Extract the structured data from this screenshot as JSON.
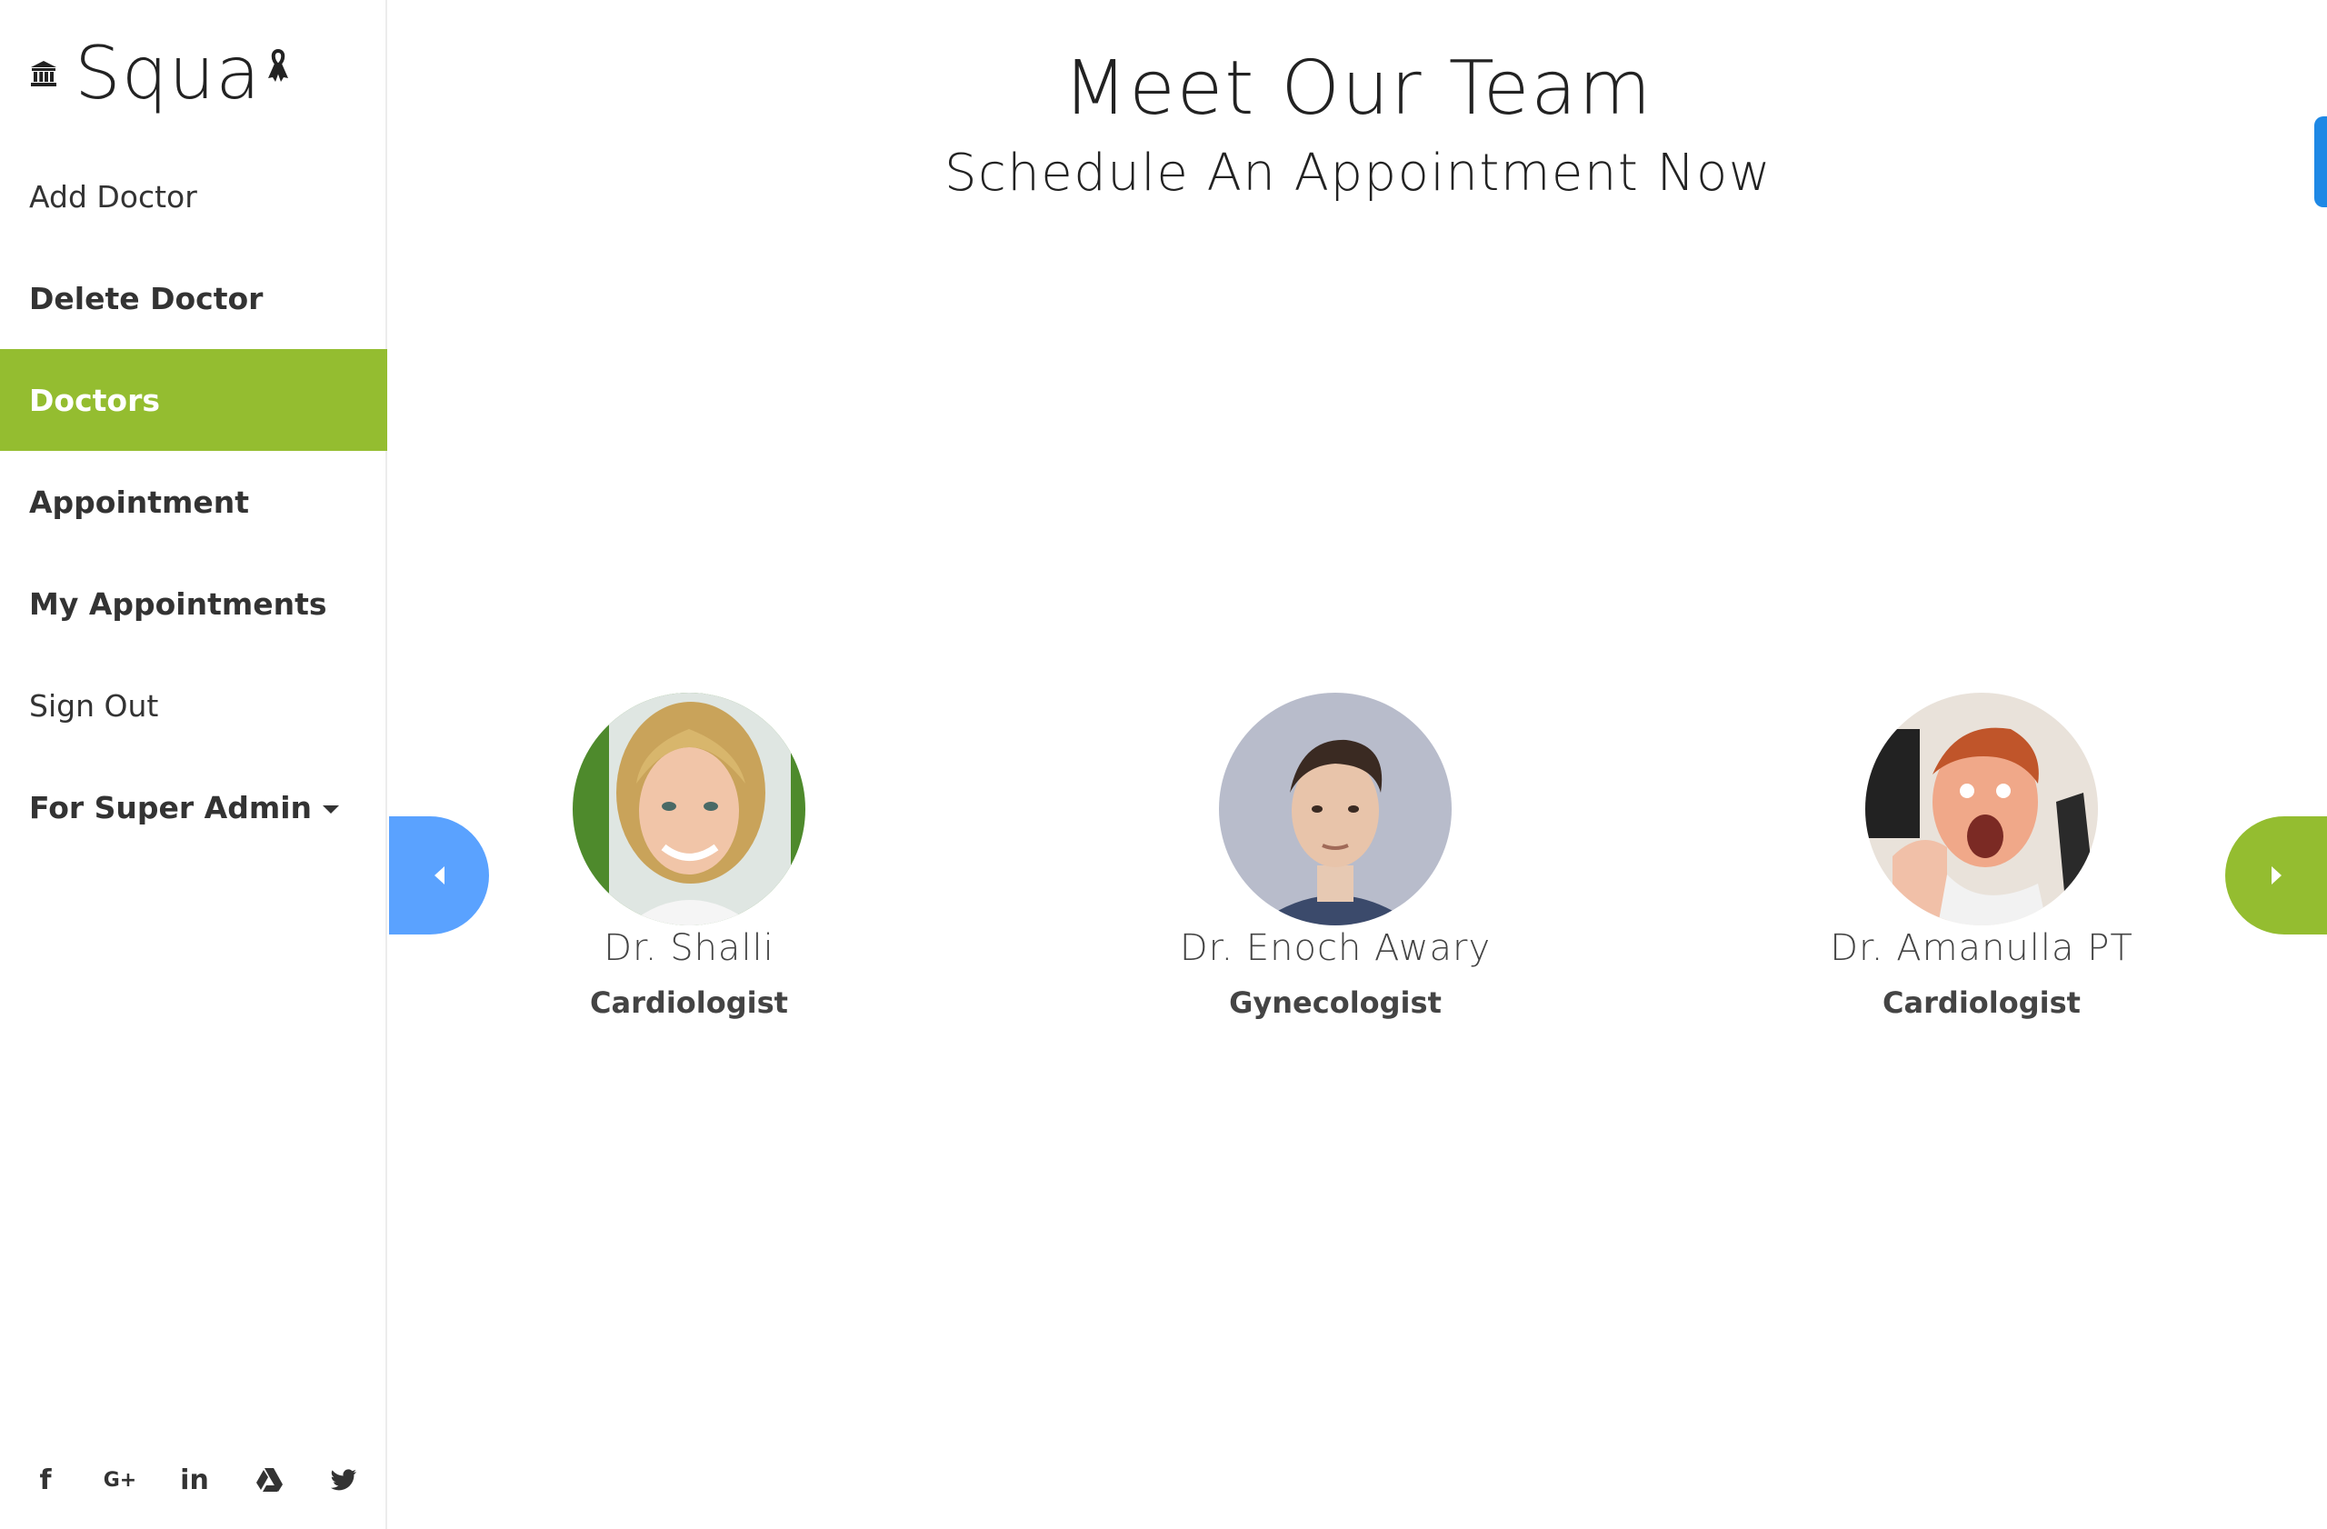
{
  "brand": {
    "name": "Squa",
    "icon": "bank-icon",
    "ribbon": "ribbon-icon"
  },
  "sidebar": {
    "items": [
      {
        "label": "Add Doctor"
      },
      {
        "label": "Delete Doctor"
      },
      {
        "label": "Doctors",
        "active": true
      },
      {
        "label": "Appointment"
      },
      {
        "label": "My Appointments"
      },
      {
        "label": "Sign Out"
      },
      {
        "label": "For Super Admin"
      }
    ],
    "social": [
      {
        "icon": "facebook-icon",
        "label": "f"
      },
      {
        "icon": "google-plus-icon",
        "label": "G+"
      },
      {
        "icon": "linkedin-icon",
        "label": "in"
      },
      {
        "icon": "google-drive-icon"
      },
      {
        "icon": "twitter-icon"
      }
    ]
  },
  "main": {
    "title": "Meet Our Team",
    "subtitle": "Schedule An Appointment Now"
  },
  "doctors": [
    {
      "name": "Dr. Shalli",
      "specialty": "Cardiologist"
    },
    {
      "name": "Dr. Enoch Awary",
      "specialty": "Gynecologist"
    },
    {
      "name": "Dr. Amanulla PT",
      "specialty": "Cardiologist"
    }
  ],
  "colors": {
    "accent_green": "#94bd30",
    "accent_blue": "#5aa2ff",
    "side_tab_blue": "#1e88e5"
  }
}
